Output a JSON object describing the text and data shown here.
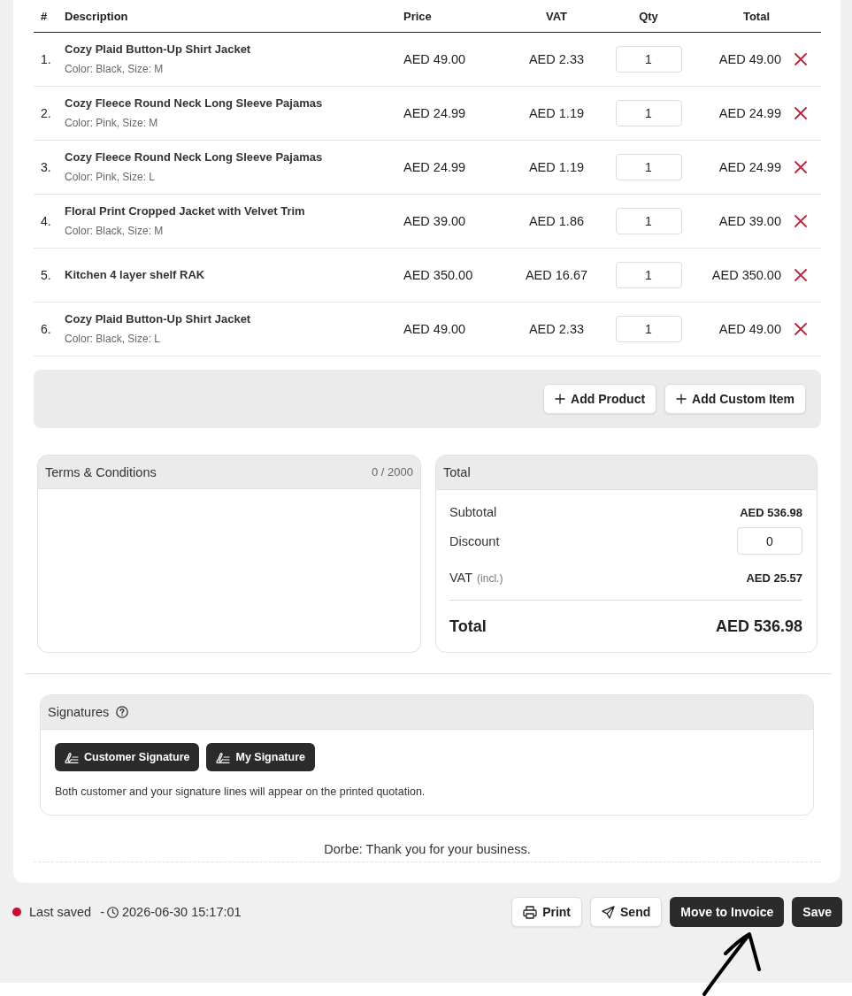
{
  "table": {
    "columns": [
      "#",
      "Description",
      "Price",
      "VAT",
      "Qty",
      "Total"
    ],
    "rows": [
      {
        "number": "1.",
        "name": "Cozy Plaid Button-Up Shirt Jacket",
        "variant": "Color: Black, Size: M",
        "price": "AED 49.00",
        "vat": "AED 2.33",
        "qty": "1",
        "total": "AED 49.00"
      },
      {
        "number": "2.",
        "name": "Cozy Fleece Round Neck Long Sleeve Pajamas",
        "variant": "Color: Pink, Size: M",
        "price": "AED 24.99",
        "vat": "AED 1.19",
        "qty": "1",
        "total": "AED 24.99"
      },
      {
        "number": "3.",
        "name": "Cozy Fleece Round Neck Long Sleeve Pajamas",
        "variant": "Color: Pink, Size: L",
        "price": "AED 24.99",
        "vat": "AED 1.19",
        "qty": "1",
        "total": "AED 24.99"
      },
      {
        "number": "4.",
        "name": "Floral Print Cropped Jacket with Velvet Trim",
        "variant": "Color: Black, Size: M",
        "price": "AED 39.00",
        "vat": "AED 1.86",
        "qty": "1",
        "total": "AED 39.00"
      },
      {
        "number": "5.",
        "name": "Kitchen 4 layer shelf RAK",
        "price": "AED 350.00",
        "vat": "AED 16.67",
        "qty": "1",
        "total": "AED 350.00"
      },
      {
        "number": "6.",
        "name": "Cozy Plaid Button-Up Shirt Jacket",
        "variant": "Color: Black, Size: L",
        "price": "AED 49.00",
        "vat": "AED 2.33",
        "qty": "1",
        "total": "AED 49.00"
      }
    ]
  },
  "add_bar": {
    "buttons": [
      "Add Product",
      "Add Custom Item"
    ]
  },
  "terms": {
    "title": "Terms & Conditions",
    "counter": "0 / 2000"
  },
  "totals": {
    "title": "Total",
    "subtotal_label": "Subtotal",
    "subtotal": "AED 536.98",
    "discount_label": "Discount",
    "discount": "0",
    "vat_label": "VAT",
    "vat_note": "(incl.)",
    "vat": "AED 25.57",
    "total_label": "Total",
    "total": "AED 536.98"
  },
  "signatures": {
    "title": "Signatures",
    "buttons": [
      "Customer Signature",
      "My Signature"
    ],
    "note": "Both customer and your signature lines will appear on the printed quotation."
  },
  "footer_note": "Dorbe: Thank you for your business.",
  "status": {
    "saved": "Last saved",
    "separator": "-",
    "timestamp": "2026-06-30 15:17:01"
  },
  "actions": [
    {
      "label": "Print",
      "kind": "print"
    },
    {
      "label": "Send",
      "kind": "send"
    },
    {
      "label": "Move to Invoice",
      "kind": "primary"
    },
    {
      "label": "Save",
      "kind": "primary"
    }
  ]
}
